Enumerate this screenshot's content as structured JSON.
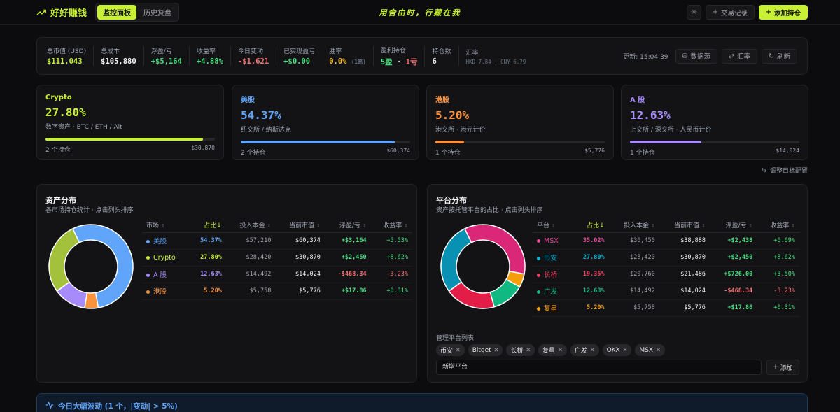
{
  "app": {
    "title": "好好赚钱",
    "tabs": [
      {
        "label": "监控面板"
      },
      {
        "label": "历史复盘"
      }
    ],
    "slogan": "用舍由时，行藏在我",
    "buttons": {
      "trades": "交易记录",
      "add_holding": "添加持仓"
    }
  },
  "summary": {
    "stats": [
      {
        "label": "总市值 (USD)",
        "value": "$111,043",
        "color": "#c8f135"
      },
      {
        "label": "总成本",
        "value": "$105,880",
        "color": "#f4f4f5"
      },
      {
        "label": "浮盈/亏",
        "value": "+$5,164",
        "color": "#4ade80"
      },
      {
        "label": "收益率",
        "value": "+4.88%",
        "color": "#4ade80"
      },
      {
        "label": "今日变动",
        "value": "-$1,621",
        "color": "#f87171"
      },
      {
        "label": "已实现盈亏",
        "value": "+$0.00",
        "color": "#4ade80"
      }
    ],
    "winrate": {
      "label": "胜率",
      "value": "0.0%",
      "sub": "(1笔)"
    },
    "profitable": {
      "label": "盈利持仓",
      "win": "5盈",
      "sep": " · ",
      "loss": "1亏"
    },
    "count": {
      "label": "持仓数",
      "value": "6"
    },
    "fx": {
      "label": "汇率",
      "value": "HKD 7.84 · CNY 6.79"
    },
    "updated": "更新: 15:04:39",
    "buttons": {
      "datasource": "数据源",
      "fx": "汇率",
      "refresh": "刷新"
    }
  },
  "markets": [
    {
      "title": "Crypto",
      "pct": "27.80%",
      "desc": "数字资产 · BTC / ETH / Alt",
      "fill": 0.93,
      "holdings": "2 个持仓",
      "value": "$30,870",
      "color": "#c8f135"
    },
    {
      "title": "美股",
      "pct": "54.37%",
      "desc": "纽交所 / 纳斯达克",
      "fill": 0.91,
      "holdings": "2 个持仓",
      "value": "$60,374",
      "color": "#60a5fa"
    },
    {
      "title": "港股",
      "pct": "5.20%",
      "desc": "港交所 · 港元计价",
      "fill": 0.17,
      "holdings": "1 个持仓",
      "value": "$5,776",
      "color": "#fb923c"
    },
    {
      "title": "A 股",
      "pct": "12.63%",
      "desc": "上交所 / 深交所 · 人民币计价",
      "fill": 0.42,
      "holdings": "1 个持仓",
      "value": "$14,024",
      "color": "#a78bfa"
    }
  ],
  "adjust_label": "调整目标配置",
  "asset_panel": {
    "title": "资产分布",
    "subtitle": "各市场持仓统计 · 点击列头排序",
    "headers": [
      "市场",
      "占比↓",
      "投入本金",
      "当前市值",
      "浮盈/亏",
      "收益率"
    ],
    "rows": [
      {
        "name": "美股",
        "pct": "54.37%",
        "cost": "$57,210",
        "value": "$60,374",
        "pnl": "+$3,164",
        "ret": "+5.53%",
        "color": "#60a5fa",
        "pnl_color": "#4ade80"
      },
      {
        "name": "Crypto",
        "pct": "27.80%",
        "cost": "$28,420",
        "value": "$30,870",
        "pnl": "+$2,450",
        "ret": "+8.62%",
        "color": "#c8f135",
        "pnl_color": "#4ade80"
      },
      {
        "name": "A 股",
        "pct": "12.63%",
        "cost": "$14,492",
        "value": "$14,024",
        "pnl": "-$468.34",
        "ret": "-3.23%",
        "color": "#a78bfa",
        "pnl_color": "#f87171"
      },
      {
        "name": "港股",
        "pct": "5.20%",
        "cost": "$5,758",
        "value": "$5,776",
        "pnl": "+$17.86",
        "ret": "+0.31%",
        "color": "#fb923c",
        "pnl_color": "#4ade80"
      }
    ],
    "donut_colors": [
      "#60a5fa",
      "#fb923c",
      "#a78bfa",
      "#a3c13a"
    ],
    "donut_values": [
      54.37,
      5.2,
      12.63,
      27.8
    ]
  },
  "platform_panel": {
    "title": "平台分布",
    "subtitle": "资产按托管平台的占比 · 点击列头排序",
    "headers": [
      "平台",
      "占比↓",
      "投入本金",
      "当前市值",
      "浮盈/亏",
      "收益率"
    ],
    "rows": [
      {
        "name": "MSX",
        "pct": "35.02%",
        "cost": "$36,450",
        "value": "$38,888",
        "pnl": "+$2,438",
        "ret": "+6.69%",
        "color": "#ec4899",
        "pnl_color": "#4ade80"
      },
      {
        "name": "币安",
        "pct": "27.80%",
        "cost": "$28,420",
        "value": "$30,870",
        "pnl": "+$2,450",
        "ret": "+8.62%",
        "color": "#06b6d4",
        "pnl_color": "#4ade80"
      },
      {
        "name": "长桥",
        "pct": "19.35%",
        "cost": "$20,760",
        "value": "$21,486",
        "pnl": "+$726.00",
        "ret": "+3.50%",
        "color": "#f43f5e",
        "pnl_color": "#4ade80"
      },
      {
        "name": "广发",
        "pct": "12.63%",
        "cost": "$14,492",
        "value": "$14,024",
        "pnl": "-$468.34",
        "ret": "-3.23%",
        "color": "#10b981",
        "pnl_color": "#f87171"
      },
      {
        "name": "复星",
        "pct": "5.20%",
        "cost": "$5,758",
        "value": "$5,776",
        "pnl": "+$17.86",
        "ret": "+0.31%",
        "color": "#f59e0b",
        "pnl_color": "#4ade80"
      }
    ],
    "donut_colors": [
      "#db2777",
      "#f59e0b",
      "#10b981",
      "#e11d48",
      "#0891b2"
    ],
    "donut_values": [
      35.02,
      5.2,
      12.63,
      19.35,
      27.8
    ],
    "manage_label": "管理平台列表",
    "chips": [
      "币安",
      "Bitget",
      "长桥",
      "复星",
      "广发",
      "OKX",
      "MSX"
    ],
    "new_input_placeholder": "新增平台",
    "add_label": "添加"
  },
  "volatility": {
    "title": "今日大幅波动 (1 个，|变动| > 5%)"
  }
}
